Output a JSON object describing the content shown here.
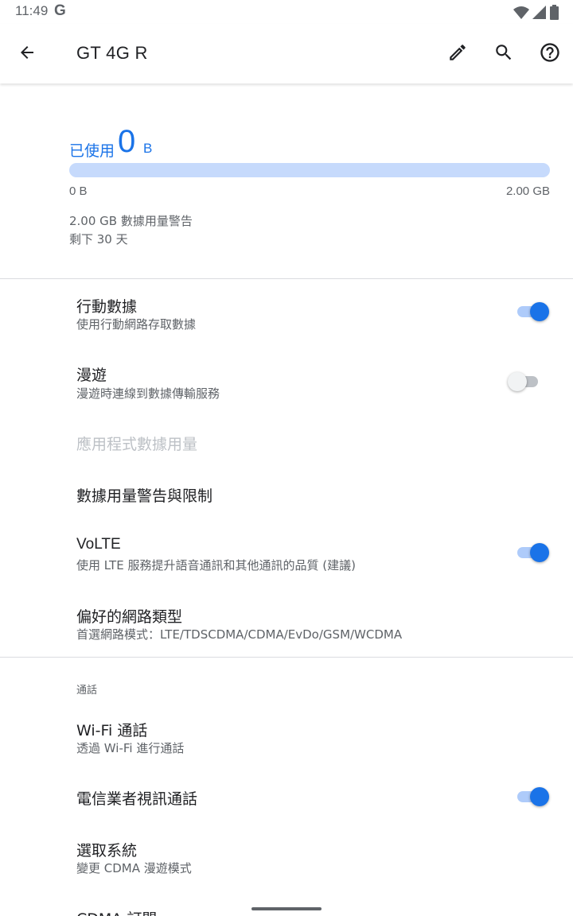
{
  "status_bar": {
    "time": "11:49",
    "g_label": "G",
    "icons": [
      "wifi-icon",
      "signal-icon",
      "battery-icon"
    ]
  },
  "app_bar": {
    "title": "GT 4G R",
    "back_icon": "arrow-back-icon",
    "edit_icon": "pencil-icon",
    "search_icon": "search-icon",
    "help_icon": "help-circle-icon"
  },
  "usage": {
    "label": "已使用",
    "value": "0",
    "unit": "B",
    "range_min": "0 B",
    "range_max": "2.00 GB",
    "progress_fraction": 0,
    "warning": "2.00 GB 數據用量警告",
    "days_left": "剩下 30 天"
  },
  "prefs": {
    "mobile_data": {
      "title": "行動數據",
      "summary": "使用行動網路存取數據",
      "enabled": true
    },
    "roaming": {
      "title": "漫遊",
      "summary": "漫遊時連線到數據傳輸服務",
      "enabled": false
    },
    "app_data_usage": {
      "title": "應用程式數據用量"
    },
    "data_warning_limit": {
      "title": "數據用量警告與限制"
    },
    "volte": {
      "title": "VoLTE",
      "summary": "使用 LTE 服務提升語音通訊和其他通訊的品質 (建議)",
      "enabled": true
    },
    "network_type": {
      "title": "偏好的網路類型",
      "summary": "首選網路模式：LTE/TDSCDMA/CDMA/EvDo/GSM/WCDMA"
    },
    "calling_category": "通話",
    "wifi_calling": {
      "title": "Wi-Fi 通話",
      "summary": "透過 Wi-Fi 進行通話"
    },
    "video_calling": {
      "title": "電信業者視訊通話",
      "enabled": true
    },
    "system_select": {
      "title": "選取系統",
      "summary": "變更 CDMA 漫遊模式"
    },
    "cdma_subscription": {
      "title": "CDMA 訂閱"
    }
  },
  "colors": {
    "accent": "#1a73e8",
    "accent_light": "#c6dafc",
    "text_primary": "#202124",
    "text_secondary": "#5f6368",
    "text_disabled": "#bdc1c6"
  }
}
